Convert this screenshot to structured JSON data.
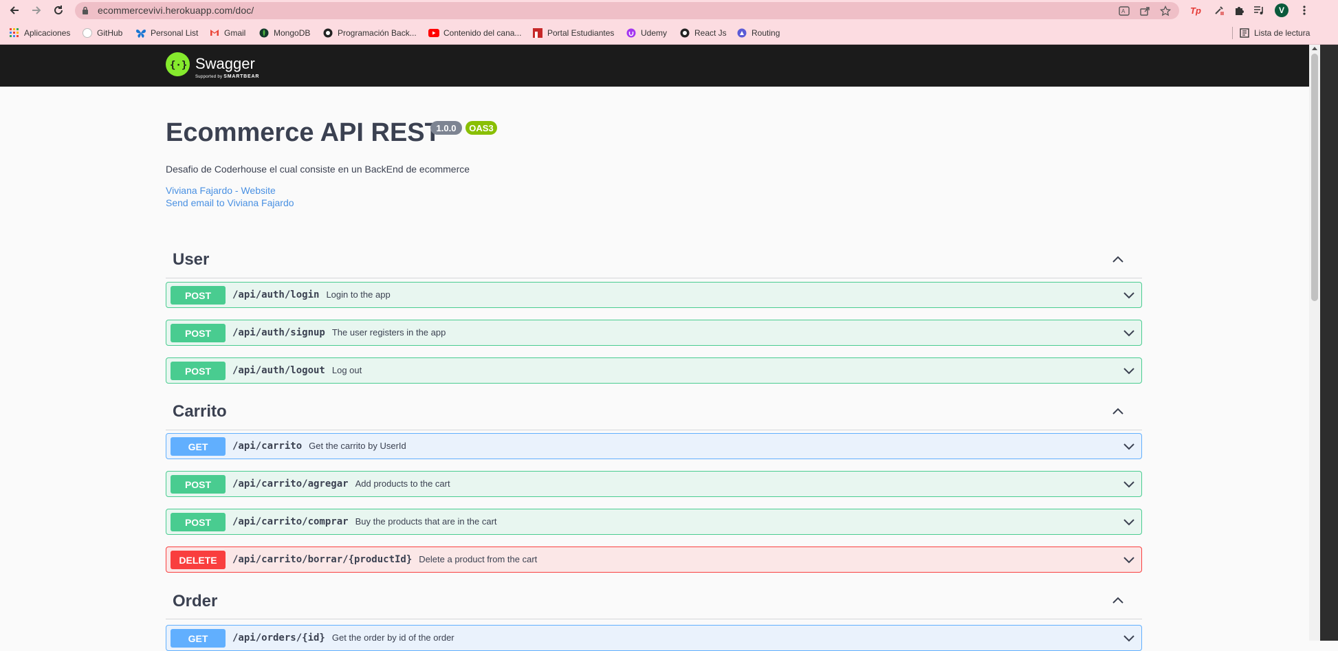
{
  "browser": {
    "url": "ecommercevivi.herokuapp.com/doc/",
    "avatar_letter": "V",
    "ext_tp_label": "Tp"
  },
  "bookmarks": {
    "items": [
      {
        "label": "Aplicaciones",
        "icon": "apps-grid-icon"
      },
      {
        "label": "GitHub",
        "icon": "github-icon"
      },
      {
        "label": "Personal List",
        "icon": "butterfly-icon"
      },
      {
        "label": "Gmail",
        "icon": "gmail-icon"
      },
      {
        "label": "MongoDB",
        "icon": "mongodb-icon"
      },
      {
        "label": "Programación Back...",
        "icon": "coderhouse-icon"
      },
      {
        "label": "Contenido del cana...",
        "icon": "youtube-icon"
      },
      {
        "label": "Portal Estudiantes",
        "icon": "portal-icon"
      },
      {
        "label": "Udemy",
        "icon": "udemy-icon"
      },
      {
        "label": "React Js",
        "icon": "coderhouse-icon"
      },
      {
        "label": "Routing",
        "icon": "routing-icon"
      }
    ],
    "reading_list": "Lista de lectura"
  },
  "swagger_header": {
    "name": "Swagger",
    "supported_by": "Supported by",
    "smartbear": "SMARTBEAR"
  },
  "info": {
    "title": "Ecommerce API REST",
    "version": "1.0.0",
    "oas": "OAS3",
    "description": "Desafio de Coderhouse el cual consiste en un BackEnd de ecommerce",
    "link_website": "Viviana Fajardo - Website",
    "link_email": "Send email to Viviana Fajardo"
  },
  "tags": [
    {
      "name": "User",
      "operations": [
        {
          "method": "POST",
          "path": "/api/auth/login",
          "summary": "Login to the app"
        },
        {
          "method": "POST",
          "path": "/api/auth/signup",
          "summary": "The user registers in the app"
        },
        {
          "method": "POST",
          "path": "/api/auth/logout",
          "summary": "Log out"
        }
      ]
    },
    {
      "name": "Carrito",
      "operations": [
        {
          "method": "GET",
          "path": "/api/carrito",
          "summary": "Get the carrito by UserId"
        },
        {
          "method": "POST",
          "path": "/api/carrito/agregar",
          "summary": "Add products to the cart"
        },
        {
          "method": "POST",
          "path": "/api/carrito/comprar",
          "summary": "Buy the products that are in the cart"
        },
        {
          "method": "DELETE",
          "path": "/api/carrito/borrar/{productId}",
          "summary": "Delete a product from the cart"
        }
      ]
    },
    {
      "name": "Order",
      "operations": [
        {
          "method": "GET",
          "path": "/api/orders/{id}",
          "summary": "Get the order by id of the order"
        }
      ]
    }
  ],
  "colors": {
    "post": "#49cc90",
    "get": "#61affe",
    "delete": "#f93e3e",
    "swagger_green": "#85ea2d",
    "link": "#4990e2"
  }
}
